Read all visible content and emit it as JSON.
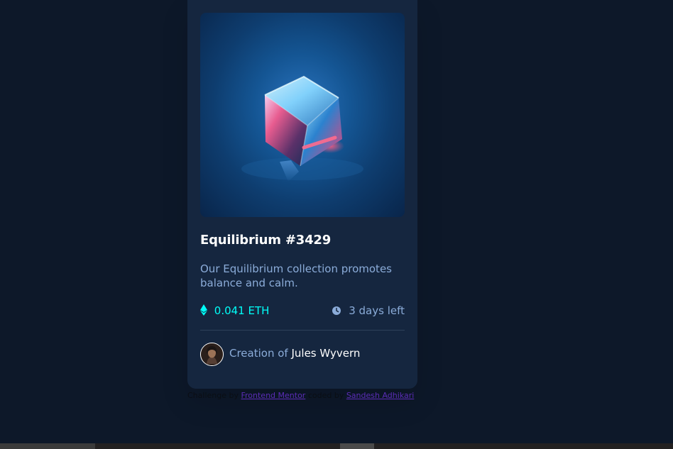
{
  "nft": {
    "title": "Equilibrium #3429",
    "description": "Our Equilibrium collection promotes balance and calm.",
    "price": "0.041 ETH",
    "time_left": "3 days left",
    "creator_prefix": "Creation of",
    "creator_name": "Jules Wyvern"
  },
  "attribution": {
    "challenge_prefix": "Challenge by",
    "challenge_link": "Frontend Mentor",
    "coded_by_prefix": "coded by",
    "coded_by_link": "Sandesh Adhikari"
  },
  "colors": {
    "page_background": "#0d1829",
    "card_background": "#15263f",
    "accent_cyan": "#00fff8",
    "muted_blue": "#8bacd9",
    "white": "#ffffff"
  },
  "icons": {
    "price": "ethereum-icon",
    "time": "clock-icon",
    "creator": "avatar"
  }
}
